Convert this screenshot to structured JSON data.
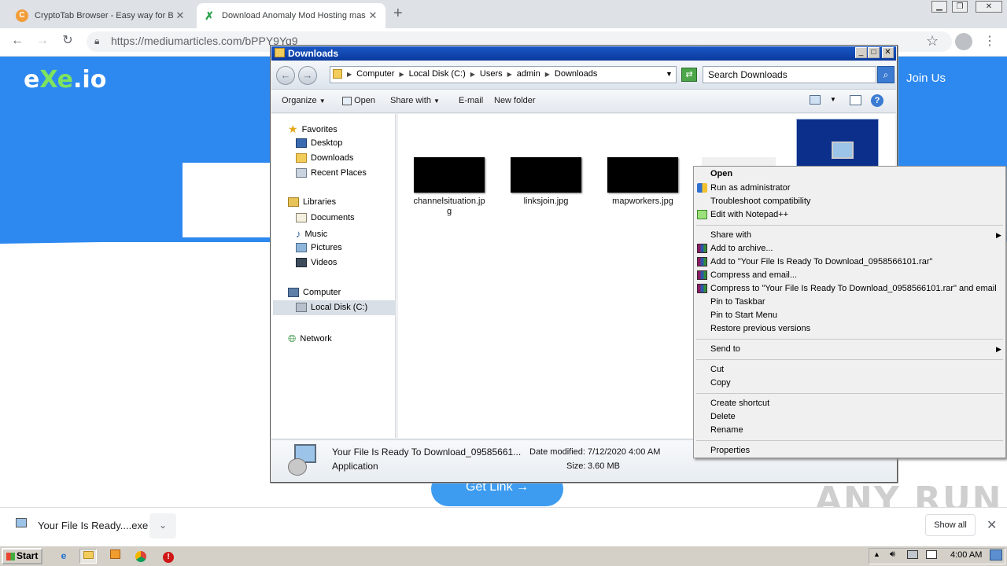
{
  "browser": {
    "tabs": [
      {
        "title": "CryptoTab Browser - Easy way for B",
        "favicon": "cryptotab-icon",
        "active": false
      },
      {
        "title": "Download Anomaly Mod Hosting mas",
        "favicon": "exeio-icon",
        "active": true
      }
    ],
    "new_tab_label": "+",
    "url": "https://mediumarticles.com/bPPY9Yq9",
    "window_controls": {
      "minimize": "▁",
      "restore": "❐",
      "close": "✕"
    }
  },
  "page": {
    "logo": {
      "prefix": "e",
      "middle": "Xe",
      "suffix": ".io"
    },
    "join_us": "Join Us",
    "get_link": "Get Link →",
    "watermark": "ANY RUN"
  },
  "download_shelf": {
    "item_name": "Your File Is Ready....exe",
    "show_all": "Show all",
    "close": "✕",
    "chevron": "⌄"
  },
  "explorer": {
    "title": "Downloads",
    "breadcrumb": [
      "Computer",
      "Local Disk (C:)",
      "Users",
      "admin",
      "Downloads"
    ],
    "search_placeholder": "Search Downloads",
    "commands": {
      "organize": "Organize",
      "open": "Open",
      "share_with": "Share with",
      "email": "E-mail",
      "new_folder": "New folder"
    },
    "nav": {
      "favorites_header": "Favorites",
      "favorites": [
        "Desktop",
        "Downloads",
        "Recent Places"
      ],
      "libraries_header": "Libraries",
      "libraries": [
        "Documents",
        "Music",
        "Pictures",
        "Videos"
      ],
      "computer_header": "Computer",
      "computer": [
        "Local Disk (C:)"
      ],
      "network_header": "Network"
    },
    "files": [
      {
        "name_line1": "channelsituation.jp",
        "name_line2": "g"
      },
      {
        "name_line1": "linksjoin.jpg",
        "name_line2": ""
      },
      {
        "name_line1": "mapworkers.jpg",
        "name_line2": ""
      }
    ],
    "details": {
      "name": "Your File Is Ready To Download_09585661...",
      "type": "Application",
      "date_modified_label": "Date modified:",
      "date_modified": "7/12/2020 4:00 AM",
      "size_label": "Size:",
      "size": "3.60 MB"
    }
  },
  "context_menu": {
    "items": [
      {
        "label": "Open",
        "bold": true
      },
      {
        "label": "Run as administrator",
        "icon": "uac-shield-icon"
      },
      {
        "label": "Troubleshoot compatibility"
      },
      {
        "label": "Edit with Notepad++",
        "icon": "notepadpp-icon"
      },
      {
        "label": "Share with",
        "submenu": true
      },
      {
        "label": "Add to archive...",
        "icon": "winrar-icon"
      },
      {
        "label": "Add to \"Your File Is Ready To Download_0958566101.rar\"",
        "icon": "winrar-icon"
      },
      {
        "label": "Compress and email...",
        "icon": "winrar-icon"
      },
      {
        "label": "Compress to \"Your File Is Ready To Download_0958566101.rar\" and email",
        "icon": "winrar-icon"
      },
      {
        "label": "Pin to Taskbar"
      },
      {
        "label": "Pin to Start Menu"
      },
      {
        "label": "Restore previous versions"
      },
      {
        "label": "Send to",
        "submenu": true
      },
      {
        "label": "Cut"
      },
      {
        "label": "Copy"
      },
      {
        "label": "Create shortcut"
      },
      {
        "label": "Delete"
      },
      {
        "label": "Rename"
      },
      {
        "label": "Properties"
      }
    ]
  },
  "taskbar": {
    "start": "Start",
    "clock": "4:00 AM"
  },
  "colors": {
    "page_blue": "#2d89ef",
    "logo_green": "#7ee35e",
    "taskbar": "#d4d0c8",
    "titlebar": "#1a58c5"
  }
}
